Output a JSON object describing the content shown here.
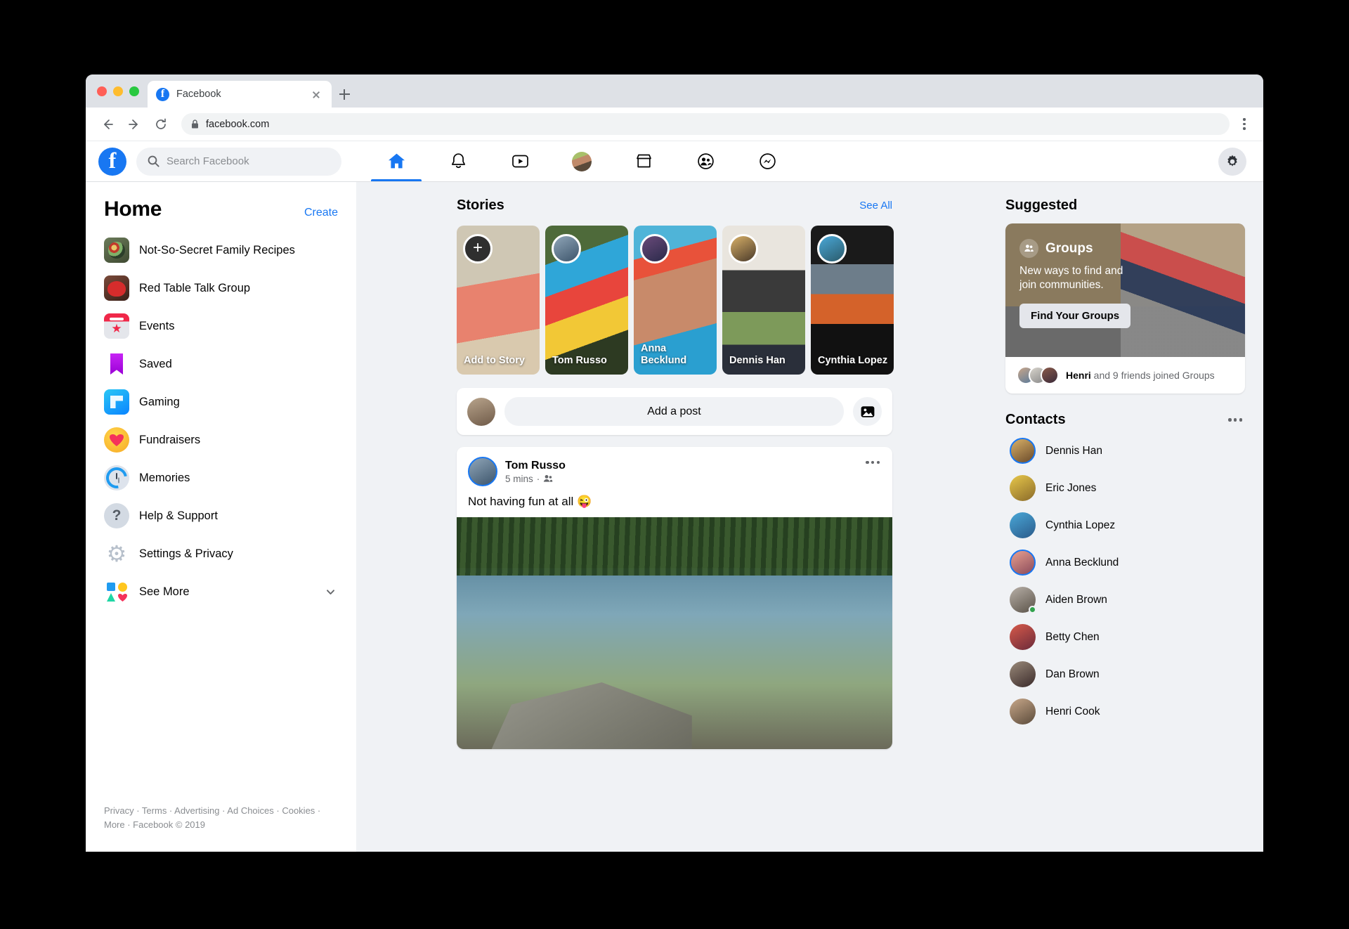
{
  "browser": {
    "tab_title": "Facebook",
    "url": "facebook.com",
    "favicon": "facebook-f-icon",
    "back_icon": "back-arrow-icon",
    "forward_icon": "forward-arrow-icon",
    "reload_icon": "reload-icon",
    "lock_icon": "lock-icon",
    "new_tab_icon": "plus-icon",
    "close_tab_icon": "close-icon",
    "menu_icon": "kebab-menu-icon"
  },
  "header": {
    "logo": "facebook-logo",
    "search_placeholder": "Search Facebook",
    "search_icon": "search-icon",
    "nav": [
      {
        "name": "home",
        "icon": "home-icon",
        "active": true
      },
      {
        "name": "notifications",
        "icon": "bell-icon",
        "active": false
      },
      {
        "name": "watch",
        "icon": "video-play-icon",
        "active": false
      },
      {
        "name": "profile",
        "icon": "profile-avatar-icon",
        "active": false
      },
      {
        "name": "marketplace",
        "icon": "storefront-icon",
        "active": false
      },
      {
        "name": "groups",
        "icon": "groups-people-icon",
        "active": false
      },
      {
        "name": "messenger",
        "icon": "messenger-icon",
        "active": false
      }
    ],
    "settings_icon": "gear-icon"
  },
  "sidebar": {
    "title": "Home",
    "create_label": "Create",
    "items": [
      {
        "label": "Not-So-Secret Family Recipes",
        "icon": "recipes-group-photo-icon"
      },
      {
        "label": "Red Table Talk Group",
        "icon": "red-table-talk-photo-icon"
      },
      {
        "label": "Events",
        "icon": "events-calendar-icon"
      },
      {
        "label": "Saved",
        "icon": "saved-bookmark-icon"
      },
      {
        "label": "Gaming",
        "icon": "gaming-controller-icon"
      },
      {
        "label": "Fundraisers",
        "icon": "fundraisers-heart-icon"
      },
      {
        "label": "Memories",
        "icon": "memories-clock-icon"
      },
      {
        "label": "Help & Support",
        "icon": "help-question-icon"
      },
      {
        "label": "Settings & Privacy",
        "icon": "settings-gear-icon"
      },
      {
        "label": "See More",
        "icon": "see-more-shapes-icon",
        "chevron": "chevron-down-icon"
      }
    ],
    "footer": "Privacy · Terms · Advertising · Ad Choices · Cookies · More · Facebook © 2019"
  },
  "stories": {
    "title": "Stories",
    "see_all_label": "See All",
    "items": [
      {
        "label": "Add to Story",
        "avatar": "add-story-plus-icon",
        "theme": "s1"
      },
      {
        "label": "Tom Russo",
        "avatar": "tom-russo-avatar",
        "theme": "s2"
      },
      {
        "label": "Anna Becklund",
        "avatar": "anna-becklund-avatar",
        "theme": "s3"
      },
      {
        "label": "Dennis Han",
        "avatar": "dennis-han-avatar",
        "theme": "s4"
      },
      {
        "label": "Cynthia Lopez",
        "avatar": "cynthia-lopez-avatar",
        "theme": "s5"
      }
    ]
  },
  "composer": {
    "avatar": "current-user-avatar",
    "placeholder": "Add a post",
    "photo_icon": "photo-image-icon"
  },
  "post": {
    "author": "Tom Russo",
    "avatar": "tom-russo-avatar",
    "time": "5 mins",
    "audience_icon": "friends-audience-icon",
    "menu_icon": "kebab-menu-icon",
    "text": "Not having fun at all 😜",
    "image": "lake-jumping-photo"
  },
  "right": {
    "suggested_title": "Suggested",
    "groups": {
      "icon": "groups-icon",
      "title": "Groups",
      "subtitle": "New ways to find and join communities.",
      "button_label": "Find Your Groups",
      "footer_prefix": "Henri",
      "footer_suffix": " and 9 friends joined Groups"
    },
    "contacts_title": "Contacts",
    "contacts_menu_icon": "kebab-menu-icon",
    "contacts": [
      {
        "name": "Dennis Han",
        "avatar": "dennis-han-avatar",
        "ring": true,
        "online": false,
        "theme": "cv1"
      },
      {
        "name": "Eric Jones",
        "avatar": "eric-jones-avatar",
        "ring": false,
        "online": false,
        "theme": "cv2"
      },
      {
        "name": "Cynthia Lopez",
        "avatar": "cynthia-lopez-avatar",
        "ring": false,
        "online": false,
        "theme": "cv3"
      },
      {
        "name": "Anna Becklund",
        "avatar": "anna-becklund-avatar",
        "ring": true,
        "online": false,
        "theme": "cv4"
      },
      {
        "name": "Aiden Brown",
        "avatar": "aiden-brown-avatar",
        "ring": false,
        "online": true,
        "theme": "cv5"
      },
      {
        "name": "Betty Chen",
        "avatar": "betty-chen-avatar",
        "ring": false,
        "online": false,
        "theme": "cv6"
      },
      {
        "name": "Dan Brown",
        "avatar": "dan-brown-avatar",
        "ring": false,
        "online": false,
        "theme": "cv7"
      },
      {
        "name": "Henri Cook",
        "avatar": "henri-cook-avatar",
        "ring": false,
        "online": false,
        "theme": "cv8"
      }
    ]
  },
  "colors": {
    "brand": "#1877f2",
    "bg": "#f0f2f5",
    "text": "#050505",
    "muted": "#65676b",
    "online": "#31a24c"
  }
}
